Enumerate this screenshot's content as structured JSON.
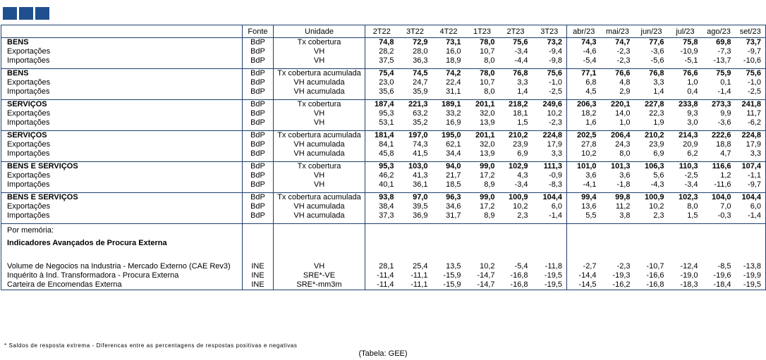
{
  "header": {
    "fonte": "Fonte",
    "unidade": "Unidade",
    "periods": [
      "2T22",
      "3T22",
      "4T22",
      "1T23",
      "2T23",
      "3T23",
      "abr/23",
      "mai/23",
      "jun/23",
      "jul/23",
      "ago/23",
      "set/23"
    ]
  },
  "groups": [
    {
      "rows": [
        {
          "label": "BENS",
          "fonte": "BdP",
          "unit": "Tx cobertura",
          "bold": true,
          "values": [
            "74,8",
            "72,9",
            "73,1",
            "78,0",
            "75,6",
            "73,2",
            "74,3",
            "74,7",
            "77,6",
            "75,8",
            "69,8",
            "73,7"
          ]
        },
        {
          "label": "Exportações",
          "fonte": "BdP",
          "unit": "VH",
          "values": [
            "28,2",
            "28,0",
            "16,0",
            "10,7",
            "-3,4",
            "-9,4",
            "-4,6",
            "-2,3",
            "-3,6",
            "-10,9",
            "-7,3",
            "-9,7"
          ]
        },
        {
          "label": "Importações",
          "fonte": "BdP",
          "unit": "VH",
          "values": [
            "37,5",
            "36,3",
            "18,9",
            "8,0",
            "-4,4",
            "-9,8",
            "-5,4",
            "-2,3",
            "-5,6",
            "-5,1",
            "-13,7",
            "-10,6"
          ]
        }
      ]
    },
    {
      "rows": [
        {
          "label": "BENS",
          "fonte": "BdP",
          "unit": "Tx cobertura acumulada",
          "bold": true,
          "values": [
            "75,4",
            "74,5",
            "74,2",
            "78,0",
            "76,8",
            "75,6",
            "77,1",
            "76,6",
            "76,8",
            "76,6",
            "75,9",
            "75,6"
          ]
        },
        {
          "label": "Exportações",
          "fonte": "BdP",
          "unit": "VH acumulada",
          "values": [
            "23,0",
            "24,7",
            "22,4",
            "10,7",
            "3,3",
            "-1,0",
            "6,8",
            "4,8",
            "3,3",
            "1,0",
            "0,1",
            "-1,0"
          ]
        },
        {
          "label": "Importações",
          "fonte": "BdP",
          "unit": "VH acumulada",
          "values": [
            "35,6",
            "35,9",
            "31,1",
            "8,0",
            "1,4",
            "-2,5",
            "4,5",
            "2,9",
            "1,4",
            "0,4",
            "-1,4",
            "-2,5"
          ]
        }
      ]
    },
    {
      "rows": [
        {
          "label": "SERVIÇOS",
          "fonte": "BdP",
          "unit": "Tx cobertura",
          "bold": true,
          "values": [
            "187,4",
            "221,3",
            "189,1",
            "201,1",
            "218,2",
            "249,6",
            "206,3",
            "220,1",
            "227,8",
            "233,8",
            "273,3",
            "241,8"
          ]
        },
        {
          "label": "Exportações",
          "fonte": "BdP",
          "unit": "VH",
          "values": [
            "95,3",
            "63,2",
            "33,2",
            "32,0",
            "18,1",
            "10,2",
            "18,2",
            "14,0",
            "22,3",
            "9,3",
            "9,9",
            "11,7"
          ]
        },
        {
          "label": "Importações",
          "fonte": "BdP",
          "unit": "VH",
          "values": [
            "53,1",
            "35,2",
            "16,9",
            "13,9",
            "1,5",
            "-2,3",
            "1,6",
            "1,0",
            "1,9",
            "3,0",
            "-3,6",
            "-6,2"
          ]
        }
      ]
    },
    {
      "rows": [
        {
          "label": "SERVIÇOS",
          "fonte": "BdP",
          "unit": "Tx cobertura acumulada",
          "bold": true,
          "values": [
            "181,4",
            "197,0",
            "195,0",
            "201,1",
            "210,2",
            "224,8",
            "202,5",
            "206,4",
            "210,2",
            "214,3",
            "222,6",
            "224,8"
          ]
        },
        {
          "label": "Exportações",
          "fonte": "BdP",
          "unit": "VH acumulada",
          "values": [
            "84,1",
            "74,3",
            "62,1",
            "32,0",
            "23,9",
            "17,9",
            "27,8",
            "24,3",
            "23,9",
            "20,9",
            "18,8",
            "17,9"
          ]
        },
        {
          "label": "Importações",
          "fonte": "BdP",
          "unit": "VH acumulada",
          "values": [
            "45,8",
            "41,5",
            "34,4",
            "13,9",
            "6,9",
            "3,3",
            "10,2",
            "8,0",
            "6,9",
            "6,2",
            "4,7",
            "3,3"
          ]
        }
      ]
    },
    {
      "rows": [
        {
          "label": "BENS E SERVIÇOS",
          "fonte": "BdP",
          "unit": "Tx cobertura",
          "bold": true,
          "values": [
            "95,3",
            "103,0",
            "94,0",
            "99,0",
            "102,9",
            "111,3",
            "101,0",
            "101,3",
            "106,3",
            "110,3",
            "116,6",
            "107,4"
          ]
        },
        {
          "label": "Exportações",
          "fonte": "BdP",
          "unit": "VH",
          "values": [
            "46,2",
            "41,3",
            "21,7",
            "17,2",
            "4,3",
            "-0,9",
            "3,6",
            "3,6",
            "5,6",
            "-2,5",
            "1,2",
            "-1,1"
          ]
        },
        {
          "label": "Importações",
          "fonte": "BdP",
          "unit": "VH",
          "values": [
            "40,1",
            "36,1",
            "18,5",
            "8,9",
            "-3,4",
            "-8,3",
            "-4,1",
            "-1,8",
            "-4,3",
            "-3,4",
            "-11,6",
            "-9,7"
          ]
        }
      ]
    },
    {
      "rows": [
        {
          "label": "BENS E SERVIÇOS",
          "fonte": "BdP",
          "unit": "Tx cobertura acumulada",
          "bold": true,
          "values": [
            "93,8",
            "97,0",
            "96,3",
            "99,0",
            "100,9",
            "104,4",
            "99,4",
            "99,8",
            "100,9",
            "102,3",
            "104,0",
            "104,4"
          ]
        },
        {
          "label": "Exportações",
          "fonte": "BdP",
          "unit": "VH acumulada",
          "values": [
            "38,4",
            "39,5",
            "34,6",
            "17,2",
            "10,2",
            "6,0",
            "13,6",
            "11,2",
            "10,2",
            "8,0",
            "7,0",
            "6,0"
          ]
        },
        {
          "label": "Importações",
          "fonte": "BdP",
          "unit": "VH acumulada",
          "values": [
            "37,3",
            "36,9",
            "31,7",
            "8,9",
            "2,3",
            "-1,4",
            "5,5",
            "3,8",
            "2,3",
            "1,5",
            "-0,3",
            "-1,4"
          ]
        }
      ]
    }
  ],
  "memo": {
    "title": "Por memória:",
    "subtitle": "Indicadores Avançados de Procura Externa",
    "rows": [
      {
        "label": "Volume de Negocios na Industria - Mercado Externo (CAE Rev3)",
        "fonte": "INE",
        "unit": "VH",
        "values": [
          "28,1",
          "25,4",
          "13,5",
          "10,2",
          "-5,4",
          "-11,8",
          "-2,7",
          "-2,3",
          "-10,7",
          "-12,4",
          "-8,5",
          "-13,8"
        ]
      },
      {
        "label": "Inquérito à Ind. Transformadora - Procura Externa",
        "fonte": "INE",
        "unit": "SRE*-VE",
        "values": [
          "-11,4",
          "-11,1",
          "-15,9",
          "-14,7",
          "-16,8",
          "-19,5",
          "-14,4",
          "-19,3",
          "-16,6",
          "-19,0",
          "-19,6",
          "-19,9"
        ]
      },
      {
        "label": "Carteira de Encomendas Externa",
        "fonte": "INE",
        "unit": "SRE*-mm3m",
        "values": [
          "-11,4",
          "-11,1",
          "-15,9",
          "-14,7",
          "-16,8",
          "-19,5",
          "-14,5",
          "-16,2",
          "-16,8",
          "-18,3",
          "-18,4",
          "-19,5"
        ]
      }
    ]
  },
  "footnote": "* Saldos de resposta extrema - Diferencas entre as percentagens de respostas positivas e negativas",
  "source": "(Tabela: GEE)"
}
